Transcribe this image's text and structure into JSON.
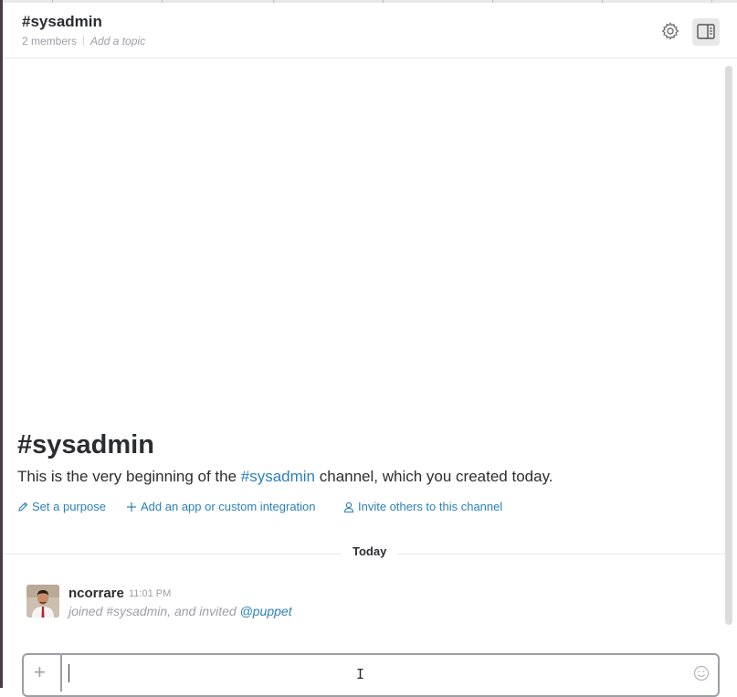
{
  "header": {
    "channel_name": "#sysadmin",
    "member_count": "2 members",
    "topic_placeholder": "Add a topic"
  },
  "intro": {
    "title": "#sysadmin",
    "text_before": "This is the very beginning of the ",
    "channel_link": "#sysadmin",
    "text_after": " channel, which you created today.",
    "actions": {
      "purpose": "Set a purpose",
      "integration": "Add an app or custom integration",
      "invite": "Invite others to this channel"
    }
  },
  "divider": {
    "label": "Today"
  },
  "message": {
    "author": "ncorrare",
    "time": "11:01 PM",
    "text": "joined #sysadmin, and invited ",
    "mention": "@puppet"
  },
  "composer": {
    "plus_label": "+",
    "value": ""
  },
  "icons": {
    "settings": "gear-icon",
    "panel": "sidebar-panel-icon",
    "pencil": "pencil-icon",
    "plus": "plus-icon",
    "person": "person-icon",
    "emoji": "smiley-icon"
  },
  "colors": {
    "link": "#2a80b9",
    "muted": "#9e9ea6",
    "text": "#2c2d30",
    "sidebar_edge": "#4d394b"
  }
}
